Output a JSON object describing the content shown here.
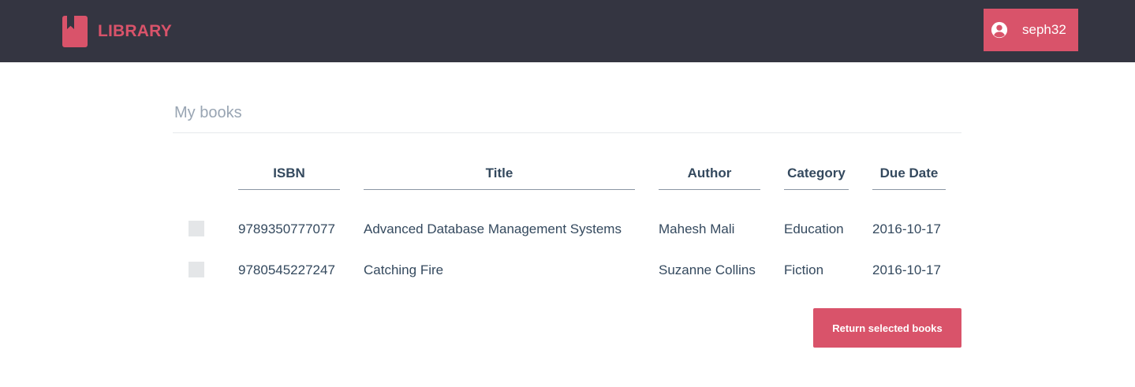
{
  "header": {
    "brand": "LIBRARY",
    "user_button_label": "seph32"
  },
  "page": {
    "title": "My books"
  },
  "table": {
    "columns": [
      "ISBN",
      "Title",
      "Author",
      "Category",
      "Due Date"
    ],
    "rows": [
      {
        "checked": false,
        "isbn": "9789350777077",
        "title": "Advanced Database Management Systems",
        "author": "Mahesh Mali",
        "category": "Education",
        "due_date": "2016-10-17"
      },
      {
        "checked": false,
        "isbn": "9780545227247",
        "title": "Catching Fire",
        "author": "Suzanne Collins",
        "category": "Fiction",
        "due_date": "2016-10-17"
      }
    ]
  },
  "actions": {
    "return_label": "Return selected books"
  },
  "colors": {
    "navbar": "#343541",
    "accent": "#d9536a",
    "text": "#34495e",
    "muted": "#99a5b3"
  },
  "icons": {
    "brand": "bookmark-book-icon",
    "user": "user-circle-icon"
  }
}
